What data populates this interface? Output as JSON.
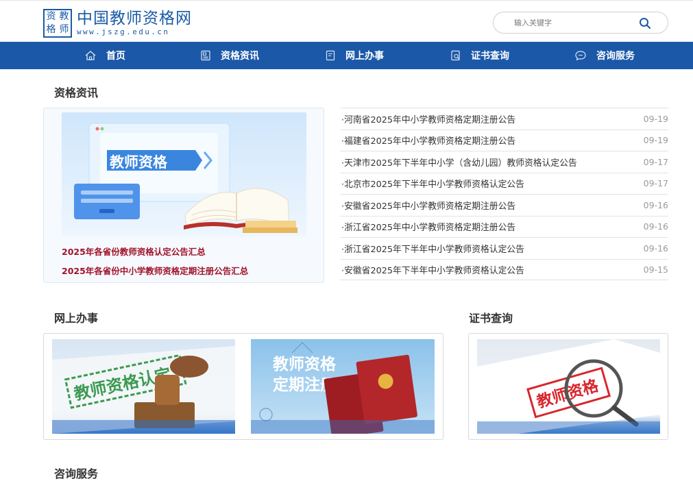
{
  "logo": {
    "seal_chars": [
      "资",
      "教",
      "格",
      "师"
    ],
    "name": "中国教师资格网",
    "url": "www.jszg.edu.cn"
  },
  "search": {
    "placeholder": "输入关键字",
    "icon": "search-icon"
  },
  "nav": {
    "items": [
      {
        "label": "首页",
        "icon": "home-icon"
      },
      {
        "label": "资格资讯",
        "icon": "news-icon"
      },
      {
        "label": "网上办事",
        "icon": "form-icon"
      },
      {
        "label": "证书查询",
        "icon": "certificate-search-icon"
      },
      {
        "label": "咨询服务",
        "icon": "chat-icon"
      }
    ]
  },
  "sections": {
    "news_title": "资格资讯",
    "online_title": "网上办事",
    "cert_title": "证书查询",
    "consult_title": "咨询服务"
  },
  "feature": {
    "banner_text": "教师资格",
    "links": [
      "2025年各省份教师资格认定公告汇总",
      "2025年各省份中小学教师资格定期注册公告汇总"
    ]
  },
  "news": [
    {
      "title": "·河南省2025年中小学教师资格定期注册公告",
      "date": "09-19"
    },
    {
      "title": "·福建省2025年中小学教师资格定期注册公告",
      "date": "09-19"
    },
    {
      "title": "·天津市2025年下半年中小学（含幼儿园）教师资格认定公告",
      "date": "09-17"
    },
    {
      "title": "·北京市2025年下半年中小学教师资格认定公告",
      "date": "09-17"
    },
    {
      "title": "·安徽省2025年中小学教师资格定期注册公告",
      "date": "09-16"
    },
    {
      "title": "·浙江省2025年中小学教师资格定期注册公告",
      "date": "09-16"
    },
    {
      "title": "·浙江省2025年下半年中小学教师资格认定公告",
      "date": "09-16"
    },
    {
      "title": "·安徽省2025年下半年中小学教师资格认定公告",
      "date": "09-15"
    }
  ],
  "cards": {
    "recognition": "教师资格认定",
    "registration_line1": "教师资格",
    "registration_line2": "定期注册",
    "query": "教师资格"
  },
  "colors": {
    "nav_blue": "#1c58a8",
    "link_red": "#a0132a",
    "logo_blue": "#1a5aa5"
  }
}
